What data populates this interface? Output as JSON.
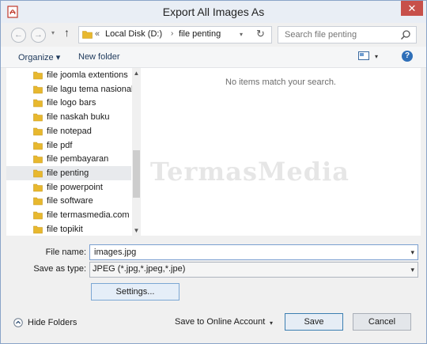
{
  "window": {
    "title": "Export All Images As",
    "close_glyph": "✕",
    "app_icon": "pdf-app-icon"
  },
  "nav": {
    "back_glyph": "←",
    "forward_glyph": "→",
    "history_glyph": "▾",
    "up_glyph": "↑",
    "address": {
      "prefix": "«",
      "segments": [
        "Local Disk (D:)",
        "file penting"
      ],
      "separator": "›",
      "dropdown_glyph": "▾",
      "refresh_glyph": "↻"
    },
    "search_placeholder": "Search file penting"
  },
  "toolbar": {
    "organize_label": "Organize ▾",
    "new_folder_label": "New folder",
    "view_drop_glyph": "▾",
    "help_glyph": "?"
  },
  "tree": {
    "items": [
      {
        "label": "file joomla extentions"
      },
      {
        "label": "file lagu tema nasionalis"
      },
      {
        "label": "file logo bars"
      },
      {
        "label": "file naskah buku"
      },
      {
        "label": "file notepad"
      },
      {
        "label": "file pdf"
      },
      {
        "label": "file pembayaran"
      },
      {
        "label": "file penting"
      },
      {
        "label": "file powerpoint"
      },
      {
        "label": "file software"
      },
      {
        "label": "file termasmedia.com"
      },
      {
        "label": "file topikit"
      }
    ],
    "selected_index": 7,
    "scroll_up_glyph": "▲",
    "scroll_down_glyph": "▼"
  },
  "content": {
    "empty_message": "No items match your search.",
    "watermark": "TermasMedia"
  },
  "form": {
    "file_name_label": "File name:",
    "file_name_value": "images.jpg",
    "save_type_label": "Save as type:",
    "save_type_value": "JPEG (*.jpg,*.jpeg,*.jpe)",
    "dropdown_glyph": "▾",
    "settings_label": "Settings..."
  },
  "footer": {
    "hide_folders_label": "Hide Folders",
    "online_account_label": "Save to Online Account",
    "online_drop_glyph": "▾",
    "save_label": "Save",
    "cancel_label": "Cancel"
  },
  "colors": {
    "accent": "#2f6fb8",
    "close": "#c7504a",
    "folder": "#e8b82e"
  }
}
